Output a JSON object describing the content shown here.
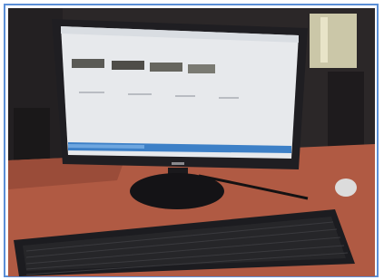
{
  "photo": {
    "subject": "desktop-computer-on-desk",
    "colors": {
      "frame_border": "#5b8fd6",
      "wall": "#2b2728",
      "desk": "#b05a43",
      "monitor_bezel": "#1f1e22",
      "screen": "#e7e9ec",
      "keyboard": "#1c1c20",
      "taskbar": "#3d80c7"
    }
  }
}
